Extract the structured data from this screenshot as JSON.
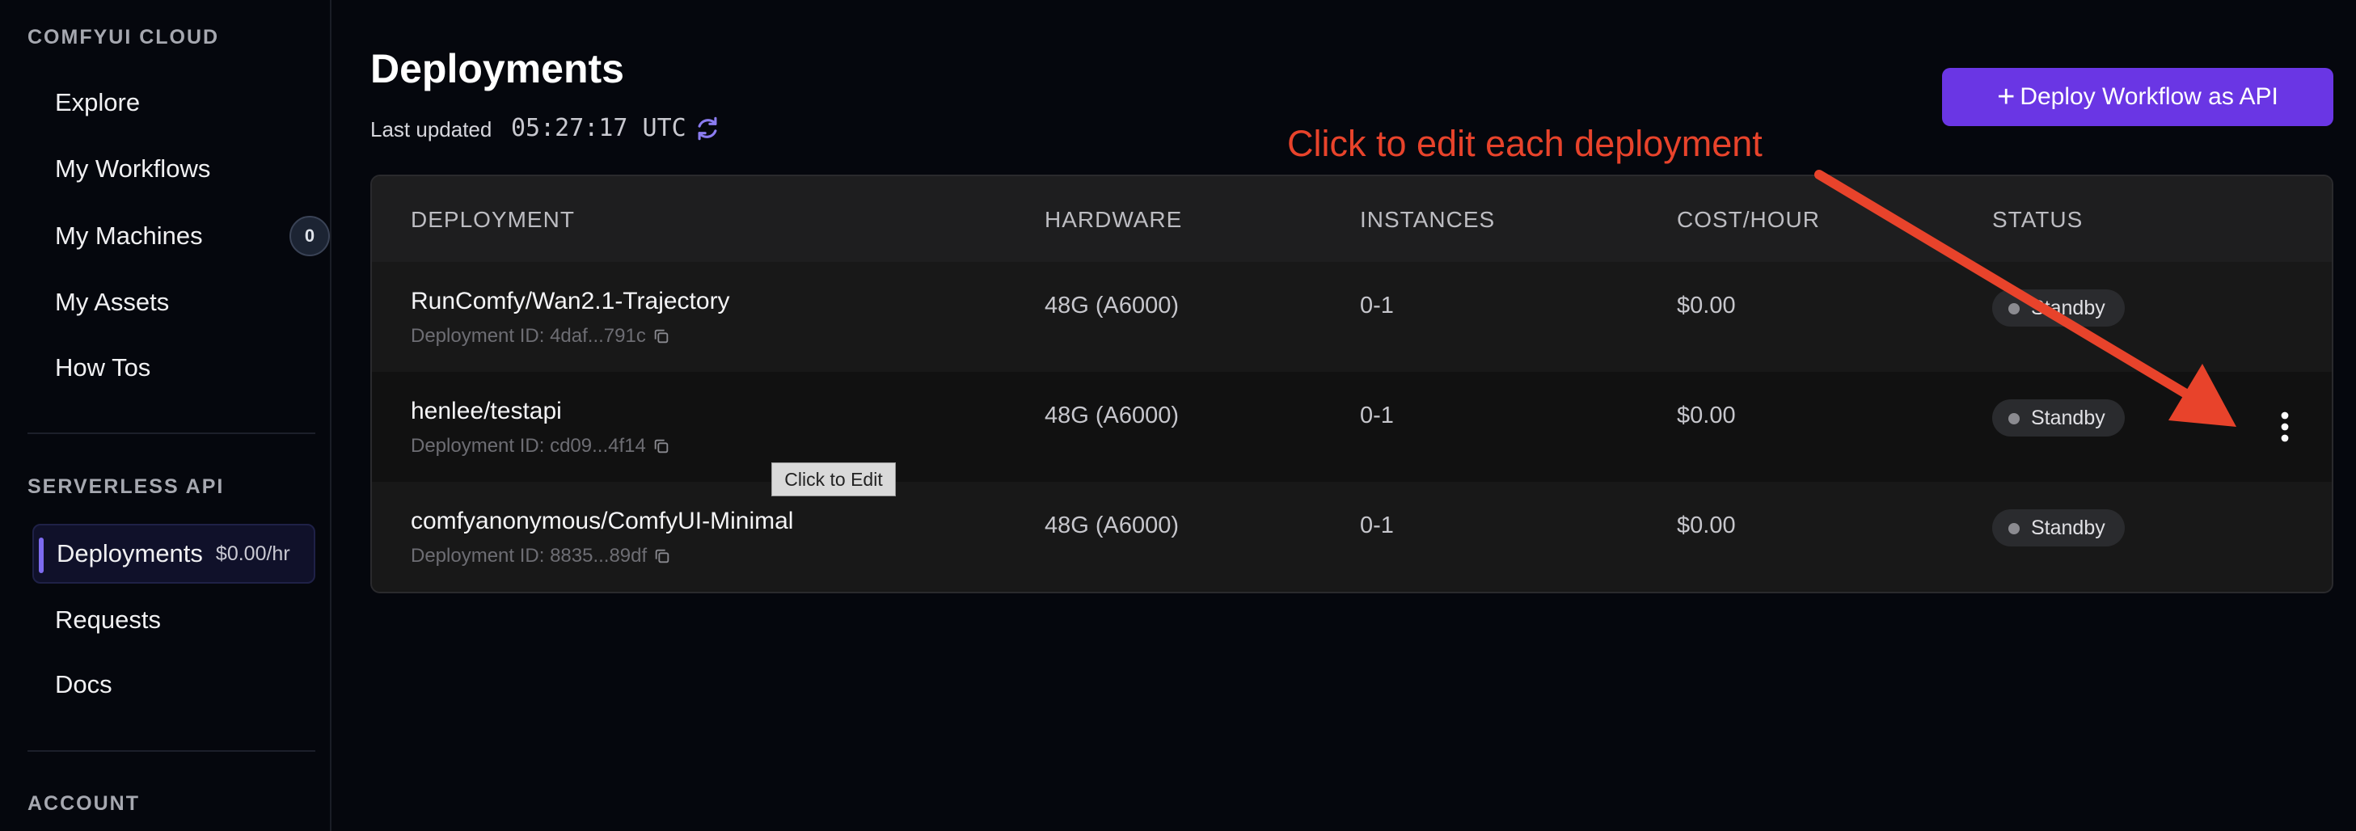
{
  "sidebar": {
    "section_cloud": "COMFYUI CLOUD",
    "cloud_items": [
      {
        "label": "Explore"
      },
      {
        "label": "My Workflows"
      },
      {
        "label": "My Machines",
        "badge": "0"
      },
      {
        "label": "My Assets"
      },
      {
        "label": "How Tos"
      }
    ],
    "section_api": "SERVERLESS API",
    "api_items": [
      {
        "label": "Deployments",
        "suffix": "$0.00/hr",
        "active": true
      },
      {
        "label": "Requests"
      },
      {
        "label": "Docs"
      }
    ],
    "section_account": "ACCOUNT"
  },
  "header": {
    "title": "Deployments",
    "last_updated_label": "Last updated",
    "last_updated_time": "05:27:17 UTC",
    "deploy_button_plus": "+",
    "deploy_button_label": "Deploy Workflow as API"
  },
  "table": {
    "columns": [
      "DEPLOYMENT",
      "HARDWARE",
      "INSTANCES",
      "COST/HOUR",
      "STATUS"
    ],
    "rows": [
      {
        "name": "RunComfy/Wan2.1-Trajectory",
        "id": "Deployment ID: 4daf...791c",
        "hardware": "48G (A6000)",
        "instances": "0-1",
        "cost": "$0.00",
        "status": "Standby"
      },
      {
        "name": "henlee/testapi",
        "id": "Deployment ID: cd09...4f14",
        "hardware": "48G (A6000)",
        "instances": "0-1",
        "cost": "$0.00",
        "status": "Standby"
      },
      {
        "name": "comfyanonymous/ComfyUI-Minimal",
        "id": "Deployment ID: 8835...89df",
        "hardware": "48G (A6000)",
        "instances": "0-1",
        "cost": "$0.00",
        "status": "Standby"
      }
    ]
  },
  "tooltip": "Click to Edit",
  "annotation": "Click to edit each deployment",
  "colors": {
    "accent": "#6a36e4",
    "annotation": "#e8432b",
    "active_indicator": "#7d6bf0"
  }
}
